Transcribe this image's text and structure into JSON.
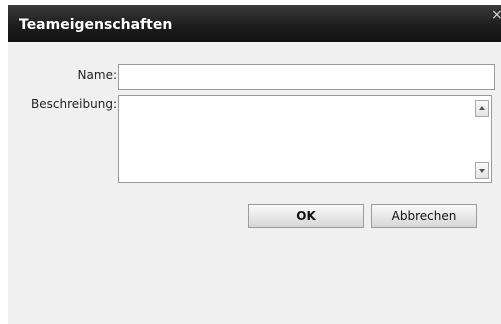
{
  "dialog": {
    "title": "Teameigenschaften",
    "close_glyph": "×"
  },
  "form": {
    "name_label": "Name:",
    "name_value": "",
    "description_label": "Beschreibung:",
    "description_value": ""
  },
  "buttons": {
    "ok_label": "OK",
    "cancel_label": "Abbrechen"
  },
  "icons": {
    "close": "close-icon",
    "scroll_up": "scroll-up-arrow-icon",
    "scroll_down": "scroll-down-arrow-icon"
  }
}
